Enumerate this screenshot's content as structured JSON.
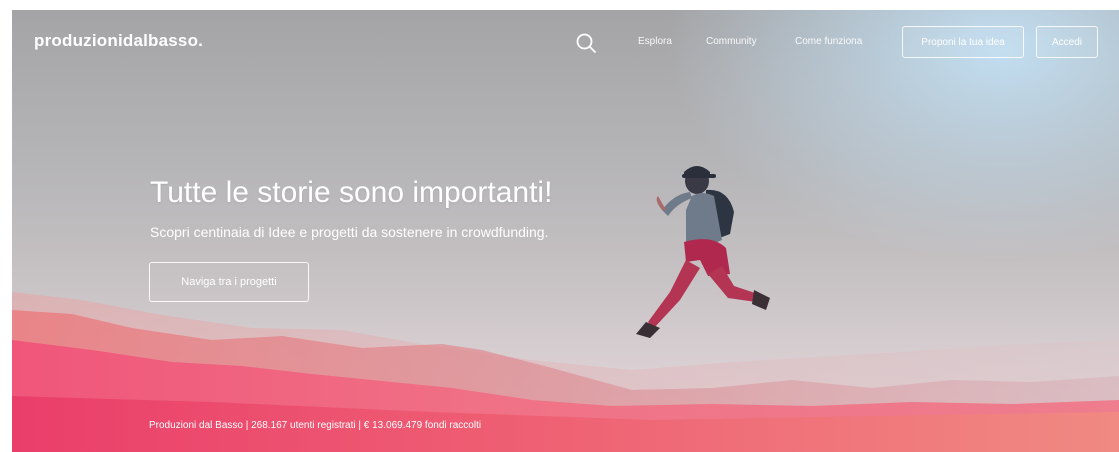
{
  "header": {
    "logo": "produzionidalbasso.",
    "search_icon": "search-icon",
    "nav": [
      "Esplora",
      "Community",
      "Come funziona"
    ],
    "propose_button": "Proponi la tua idea",
    "login_button": "Accedi"
  },
  "hero": {
    "title": "Tutte le storie sono importanti!",
    "subtitle": "Scopri centinaia di Idee e progetti da sostenere in crowdfunding.",
    "cta_label": "Naviga tra i progetti"
  },
  "footer": {
    "stats": "Produzioni dal Basso | 268.167 utenti registrati | € 13.069.479 fondi raccolti"
  },
  "colors": {
    "accent_pink": "#e63a6c",
    "accent_orange": "#f2916b",
    "sky_blue": "#c3e1f5"
  }
}
